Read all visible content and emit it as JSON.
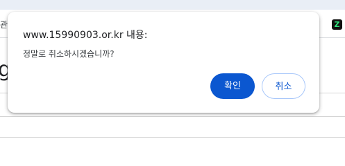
{
  "browser": {
    "bookmark_fragment": "관리",
    "extension_icon": {
      "name": "green-z-extension-icon",
      "glyph": "Z"
    }
  },
  "page": {
    "partial_heading": "g"
  },
  "dialog": {
    "title": "www.15990903.or.kr 내용:",
    "message": "정말로 취소하시겠습니까?",
    "confirm_label": "확인",
    "cancel_label": "취소"
  },
  "colors": {
    "accent": "#0b57d0",
    "tabstrip": "#e9eef6"
  }
}
